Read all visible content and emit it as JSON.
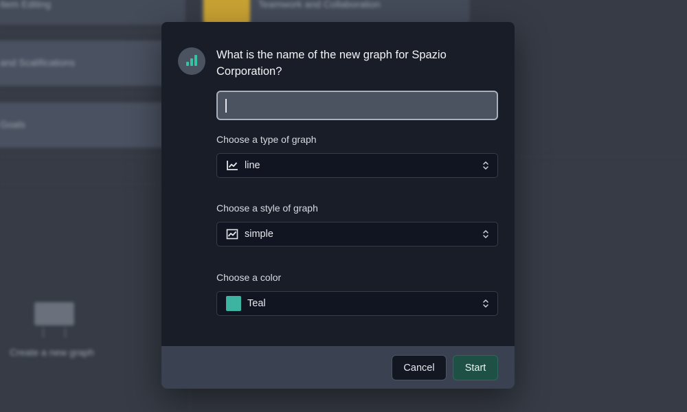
{
  "background": {
    "card_top_left": "Item Editing",
    "card_top_right": "Teamwork and Collaboration",
    "card_1": "and Scalifications",
    "card_2": "Goals",
    "create_label": "Create a new graph"
  },
  "modal": {
    "title": "What is the name of the new graph for Spazio Corporation?",
    "name_input": {
      "value": "",
      "placeholder": ""
    },
    "type_field": {
      "label": "Choose a type of graph",
      "value": "line",
      "icon": "line-chart-icon"
    },
    "style_field": {
      "label": "Choose a style of graph",
      "value": "simple",
      "icon": "area-chart-icon"
    },
    "color_field": {
      "label": "Choose a color",
      "value": "Teal",
      "swatch": "#3db3a2"
    },
    "cancel_label": "Cancel",
    "start_label": "Start"
  },
  "colors": {
    "accent": "#34c3a3",
    "start_button": "#1f5045"
  }
}
